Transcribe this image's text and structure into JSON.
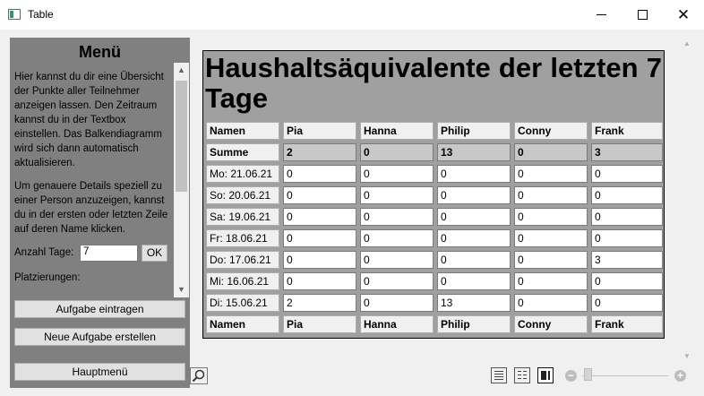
{
  "window": {
    "title": "Table"
  },
  "sidebar": {
    "title": "Menü",
    "text1": "Hier kannst du dir eine Übersicht der Punkte aller Teilnehmer anzeigen lassen. Den Zeitraum kannst du in der Textbox einstellen. Das Balkendiagramm wird sich dann automatisch aktualisieren.",
    "text2": "Um genauere Details speziell zu einer Person anzuzeigen, kannst du in der ersten oder letzten Zeile auf deren Name klicken.",
    "days_label": "Anzahl Tage:",
    "days_value": "7",
    "ok_label": "OK",
    "rank_label": "Platzierungen:",
    "btn_enter": "Aufgabe eintragen",
    "btn_new": "Neue Aufgabe erstellen",
    "btn_main": "Hauptmenü"
  },
  "table": {
    "heading": "Haushaltsäquivalente der letzten 7 Tage",
    "names_label": "Namen",
    "sum_label": "Summe",
    "people": [
      "Pia",
      "Hanna",
      "Philip",
      "Conny",
      "Frank"
    ],
    "sums": [
      "2",
      "0",
      "13",
      "0",
      "3"
    ],
    "rows": [
      {
        "date": "Mo: 21.06.21",
        "values": [
          "0",
          "0",
          "0",
          "0",
          "0"
        ]
      },
      {
        "date": "So: 20.06.21",
        "values": [
          "0",
          "0",
          "0",
          "0",
          "0"
        ]
      },
      {
        "date": "Sa: 19.06.21",
        "values": [
          "0",
          "0",
          "0",
          "0",
          "0"
        ]
      },
      {
        "date": "Fr: 18.06.21",
        "values": [
          "0",
          "0",
          "0",
          "0",
          "0"
        ]
      },
      {
        "date": "Do: 17.06.21",
        "values": [
          "0",
          "0",
          "0",
          "0",
          "3"
        ]
      },
      {
        "date": "Mi: 16.06.21",
        "values": [
          "0",
          "0",
          "0",
          "0",
          "0"
        ]
      },
      {
        "date": "Di: 15.06.21",
        "values": [
          "2",
          "0",
          "13",
          "0",
          "0"
        ]
      }
    ]
  }
}
